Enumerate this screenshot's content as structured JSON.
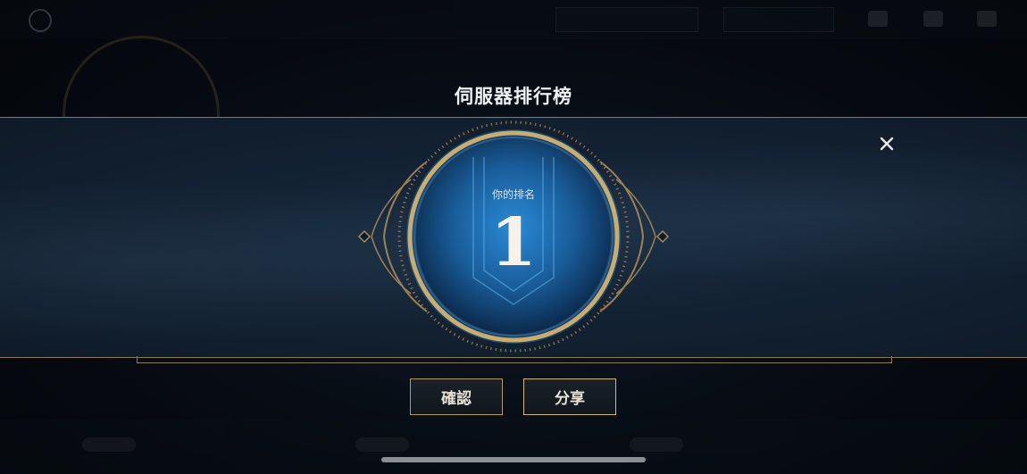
{
  "dialog": {
    "title": "伺服器排行榜",
    "rank_label": "你的排名",
    "rank_value": "1",
    "close_icon": "close-icon"
  },
  "buttons": {
    "confirm_label": "確認",
    "share_label": "分享"
  },
  "colors": {
    "gold_accent": "#b49a5f",
    "emblem_blue": "#1d6db5",
    "banner_bg": "#132233"
  }
}
